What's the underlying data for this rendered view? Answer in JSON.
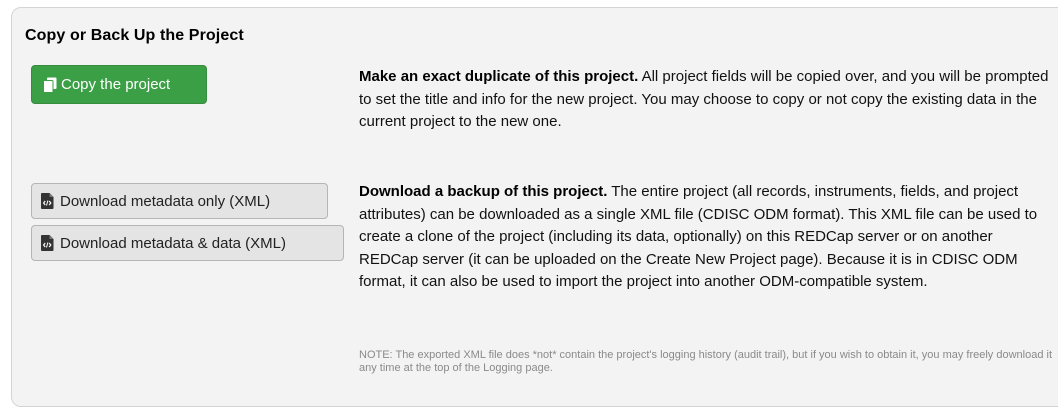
{
  "section": {
    "title": "Copy or Back Up the Project"
  },
  "copy": {
    "button_label": "Copy the project",
    "description_bold": "Make an exact duplicate of this project.",
    "description_text": " All project fields will be copied over, and you will be prompted to set the title and info for the new project. You may choose to copy or not copy the existing data in the current project to the new one.",
    "button_color": "#3b9f45"
  },
  "backup": {
    "metadata_only_label": "Download metadata only (XML)",
    "metadata_data_label": "Download metadata & data (XML)",
    "description_bold": "Download a backup of this project.",
    "description_text": " The entire project (all records, instruments, fields, and project attributes) can be downloaded as a single XML file (CDISC ODM format). This XML file can be used to create a clone of the project (including its data, optionally) on this REDCap server or on another REDCap server (it can be uploaded on the Create New Project page). Because it is in CDISC ODM format, it can also be used to import the project into another ODM-compatible system.",
    "note": "NOTE: The exported XML file does *not* contain the project's logging history (audit trail), but if you wish to obtain it, you may freely download it any time at the top of the Logging page."
  },
  "icons": {
    "copy_icon": "copy-icon",
    "xml_file_icon": "file-code-icon"
  }
}
